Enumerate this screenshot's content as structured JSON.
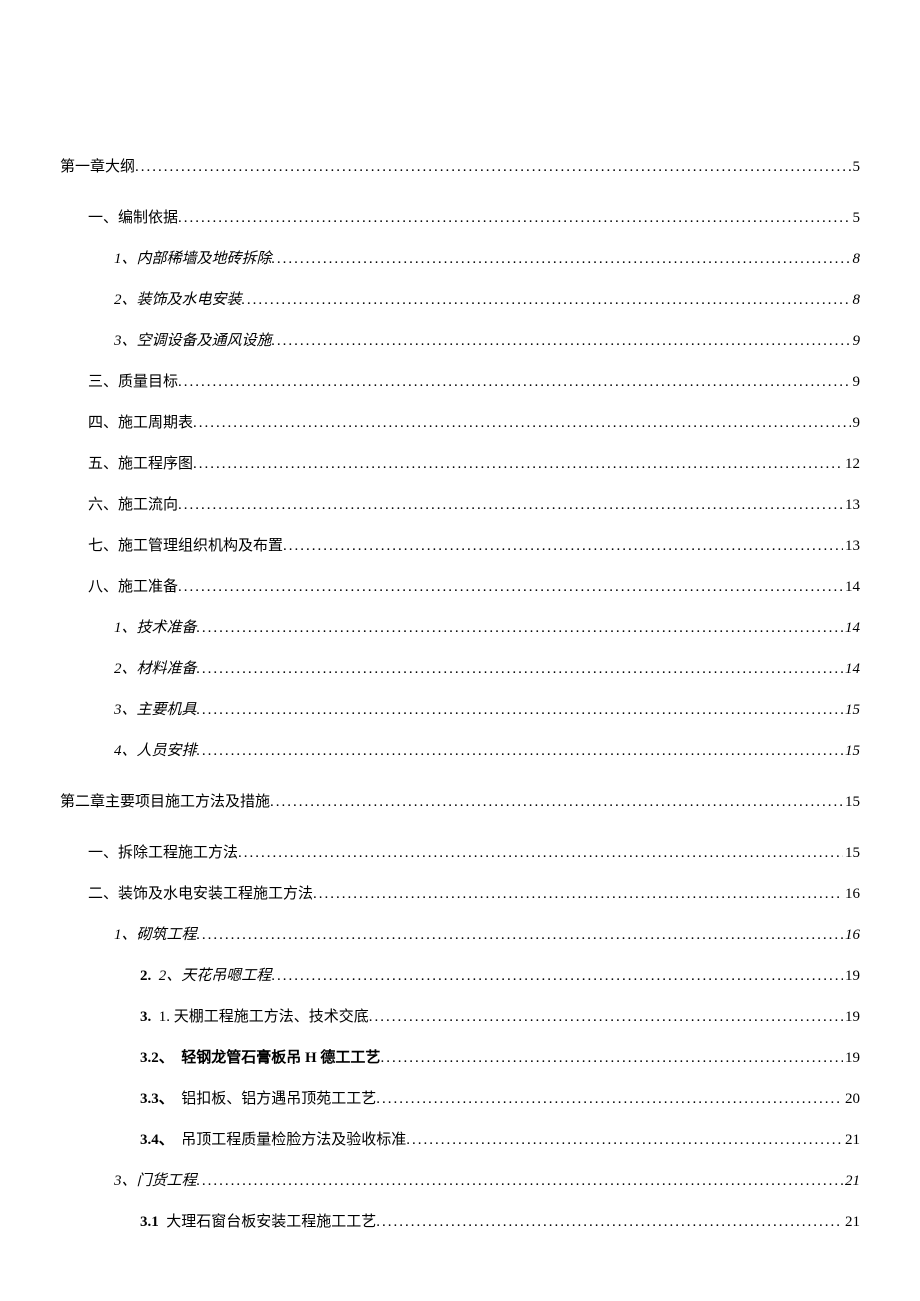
{
  "toc": [
    {
      "level": 1,
      "label": "第一章大纲",
      "page": "5",
      "extra_class": "first"
    },
    {
      "level": 2,
      "label": "一、编制依据",
      "page": "5",
      "extra_class": "gap-chapter"
    },
    {
      "level": 3,
      "label": "1、内部稀墙及地砖拆除",
      "page": "8"
    },
    {
      "level": 3,
      "label": "2、装饰及水电安装",
      "page": "8"
    },
    {
      "level": 3,
      "label": "3、空调设备及通风设施",
      "page": "9"
    },
    {
      "level": 2,
      "label": "三、质量目标",
      "page": "9"
    },
    {
      "level": 2,
      "label": "四、施工周期表",
      "page": "9"
    },
    {
      "level": 2,
      "label": "五、施工程序图",
      "page": "12"
    },
    {
      "level": 2,
      "label": "六、施工流向",
      "page": "13"
    },
    {
      "level": 2,
      "label": "七、施工管理组织机构及布置",
      "page": "13"
    },
    {
      "level": 2,
      "label": "八、施工准备",
      "page": "14"
    },
    {
      "level": 3,
      "label": "1、技术准备",
      "page": "14"
    },
    {
      "level": 3,
      "label": "2、材料准备",
      "page": "14"
    },
    {
      "level": 3,
      "label": "3、主要机具",
      "page": "15"
    },
    {
      "level": 3,
      "label": "4、人员安排",
      "page": "15"
    },
    {
      "level": 1,
      "label": "第二章主要项目施工方法及措施",
      "page": "15",
      "extra_class": "gap-chapter"
    },
    {
      "level": 2,
      "label": "一、拆除工程施工方法",
      "page": "15",
      "extra_class": "gap-chapter"
    },
    {
      "level": 2,
      "label": "二、装饰及水电安装工程施工方法",
      "page": "16"
    },
    {
      "level": 3,
      "label": "1、砌筑工程",
      "page": "16"
    },
    {
      "level": 4,
      "num": "2.",
      "txt": "2、天花吊嗯工程",
      "page": "19",
      "italic_txt": true
    },
    {
      "level": 4,
      "num": "3.",
      "txt": "1. 天棚工程施工方法、技术交底",
      "page": "19"
    },
    {
      "level": 4,
      "num": "3.2、",
      "txt": "轻钢龙管石膏板吊 H 德工工艺",
      "page": "19",
      "bold_txt": true
    },
    {
      "level": 4,
      "num": "3.3、",
      "txt": "铝扣板、铝方遇吊顶苑工工艺",
      "page": "20"
    },
    {
      "level": 4,
      "num": "3.4、",
      "txt": "吊顶工程质量检脸方法及验收标准",
      "page": "21"
    },
    {
      "level": 3,
      "label": "3、门货工程",
      "page": "21"
    },
    {
      "level": 4,
      "num": "3.1",
      "txt": "大理石窗台板安装工程施工工艺",
      "page": "21"
    }
  ]
}
